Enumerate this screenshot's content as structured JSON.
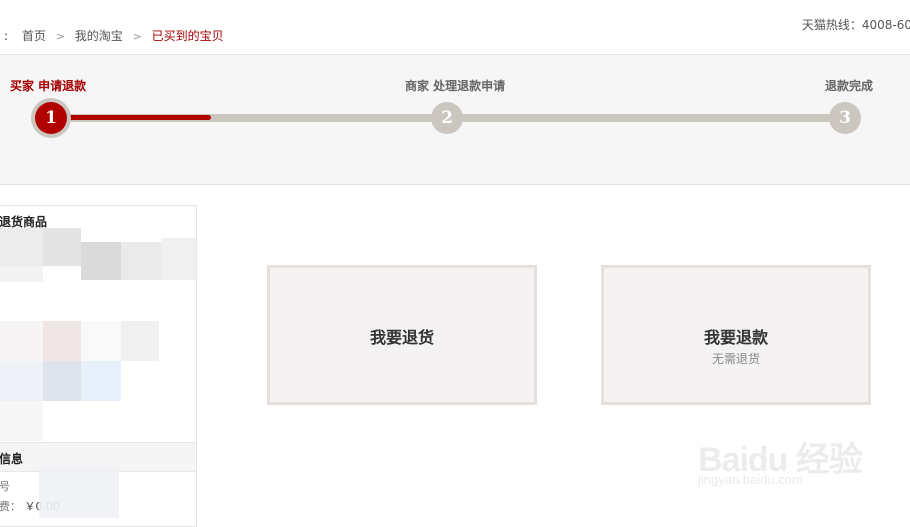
{
  "breadcrumb": {
    "prefix": ":",
    "items": [
      "首页",
      "我的淘宝",
      "已买到的宝贝"
    ],
    "separator": ">"
  },
  "hotline": "天猫热线：4008-60",
  "steps": [
    {
      "label": "买家 申请退款",
      "number": "1",
      "state": "active"
    },
    {
      "label": "商家 处理退款申请",
      "number": "2",
      "state": "pending"
    },
    {
      "label": "退款完成",
      "number": "3",
      "state": "pending"
    }
  ],
  "progress_fraction": 0.2,
  "product_panel": {
    "title": "退货商品",
    "section_title": "信息",
    "row1_label": "号",
    "row2_label": "费：",
    "row2_value": "￥0.00"
  },
  "options": [
    {
      "title": "我要退货",
      "subtitle": ""
    },
    {
      "title": "我要退款",
      "subtitle": "无需退货"
    }
  ],
  "watermark": {
    "logo": "Baidu 经验",
    "url": "jingyan.baidu.com"
  },
  "colors": {
    "accent": "#b00000",
    "track": "#ccc6c0",
    "card_bg": "#f4f2f2",
    "card_border": "#e5e0db"
  }
}
